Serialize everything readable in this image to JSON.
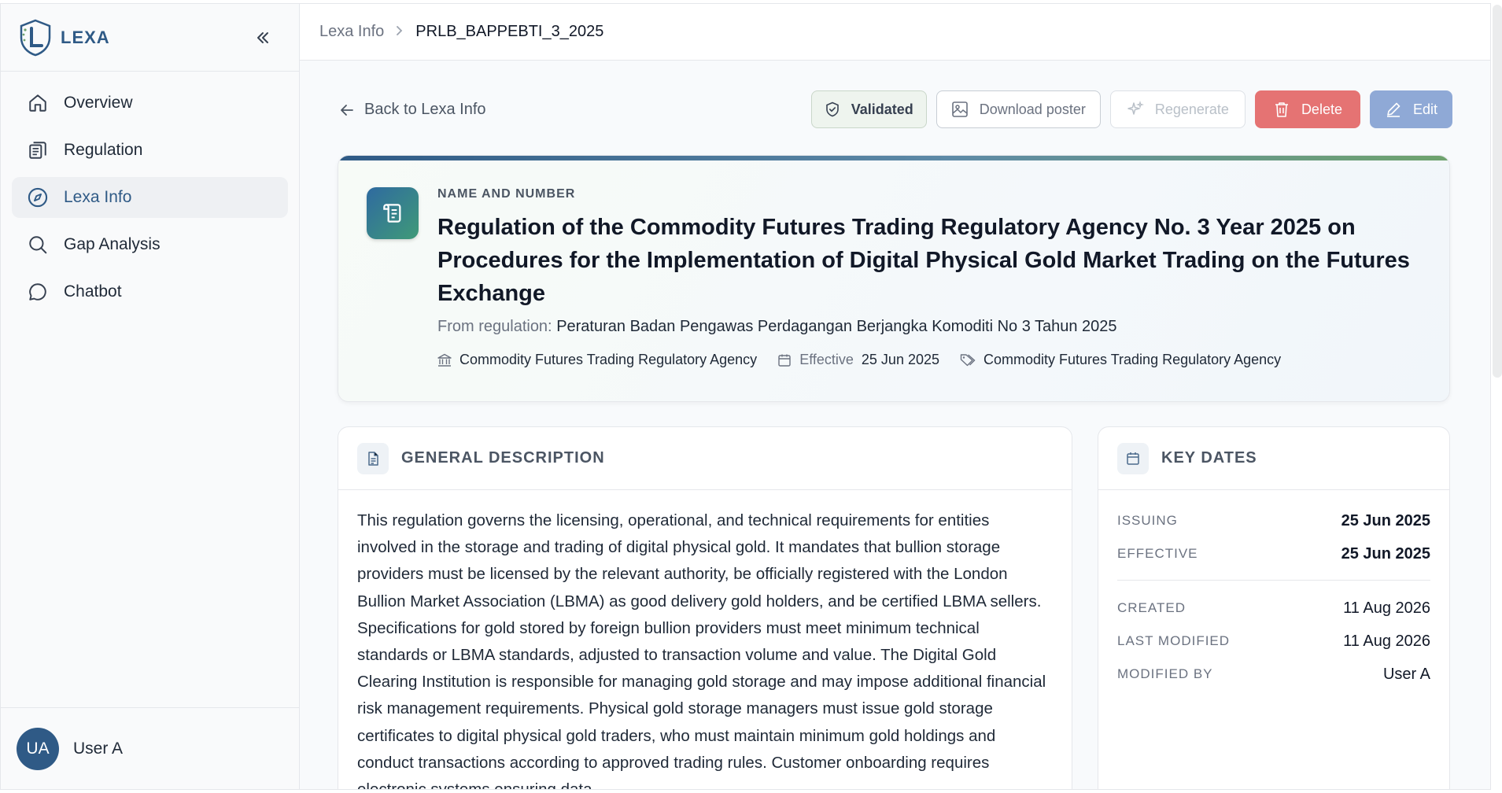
{
  "brand": {
    "name": "LEXA"
  },
  "sidebar": {
    "items": [
      {
        "label": "Overview",
        "icon": "home-icon",
        "active": false
      },
      {
        "label": "Regulation",
        "icon": "document-list-icon",
        "active": false
      },
      {
        "label": "Lexa Info",
        "icon": "compass-icon",
        "active": true
      },
      {
        "label": "Gap Analysis",
        "icon": "search-icon",
        "active": false
      },
      {
        "label": "Chatbot",
        "icon": "chat-bubble-icon",
        "active": false
      }
    ],
    "user": {
      "initials": "UA",
      "name": "User A"
    }
  },
  "breadcrumb": {
    "parent": "Lexa Info",
    "current": "PRLB_BAPPEBTI_3_2025"
  },
  "back_label": "Back to Lexa Info",
  "actions": {
    "validated": "Validated",
    "download": "Download poster",
    "regenerate": "Regenerate",
    "delete": "Delete",
    "edit": "Edit"
  },
  "hero": {
    "eyebrow": "NAME AND NUMBER",
    "title": "Regulation of the Commodity Futures Trading Regulatory Agency No. 3 Year 2025 on Procedures for the Implementation of Digital Physical Gold Market Trading on the Futures Exchange",
    "from_label": "From regulation:",
    "from_value": "Peraturan Badan Pengawas Perdagangan Berjangka Komoditi No 3 Tahun 2025",
    "agency": "Commodity Futures Trading Regulatory Agency",
    "effective_label": "Effective",
    "effective_date": "25 Jun 2025",
    "tag": "Commodity Futures Trading Regulatory Agency"
  },
  "description": {
    "title": "GENERAL DESCRIPTION",
    "text": "This regulation governs the licensing, operational, and technical requirements for entities involved in the storage and trading of digital physical gold. It mandates that bullion storage providers must be licensed by the relevant authority, be officially registered with the London Bullion Market Association (LBMA) as good delivery gold holders, and be certified LBMA sellers. Specifications for gold stored by foreign bullion providers must meet minimum technical standards or LBMA standards, adjusted to transaction volume and value. The Digital Gold Clearing Institution is responsible for managing gold storage and may impose additional financial risk management requirements. Physical gold storage managers must issue gold storage certificates to digital physical gold traders, who must maintain minimum gold holdings and conduct transactions according to approved trading rules. Customer onboarding requires electronic systems ensuring data"
  },
  "key_dates": {
    "title": "KEY DATES",
    "rows": [
      {
        "label": "ISSUING",
        "value": "25 Jun 2025"
      },
      {
        "label": "EFFECTIVE",
        "value": "25 Jun 2025"
      }
    ],
    "meta_rows": [
      {
        "label": "CREATED",
        "value": "11 Aug 2026"
      },
      {
        "label": "LAST MODIFIED",
        "value": "11 Aug 2026"
      },
      {
        "label": "MODIFIED BY",
        "value": "User A"
      }
    ]
  },
  "colors": {
    "brand": "#2f5a86",
    "delete": "#e57373",
    "edit": "#8fa9d6",
    "validated_bg": "#eef4ee"
  }
}
